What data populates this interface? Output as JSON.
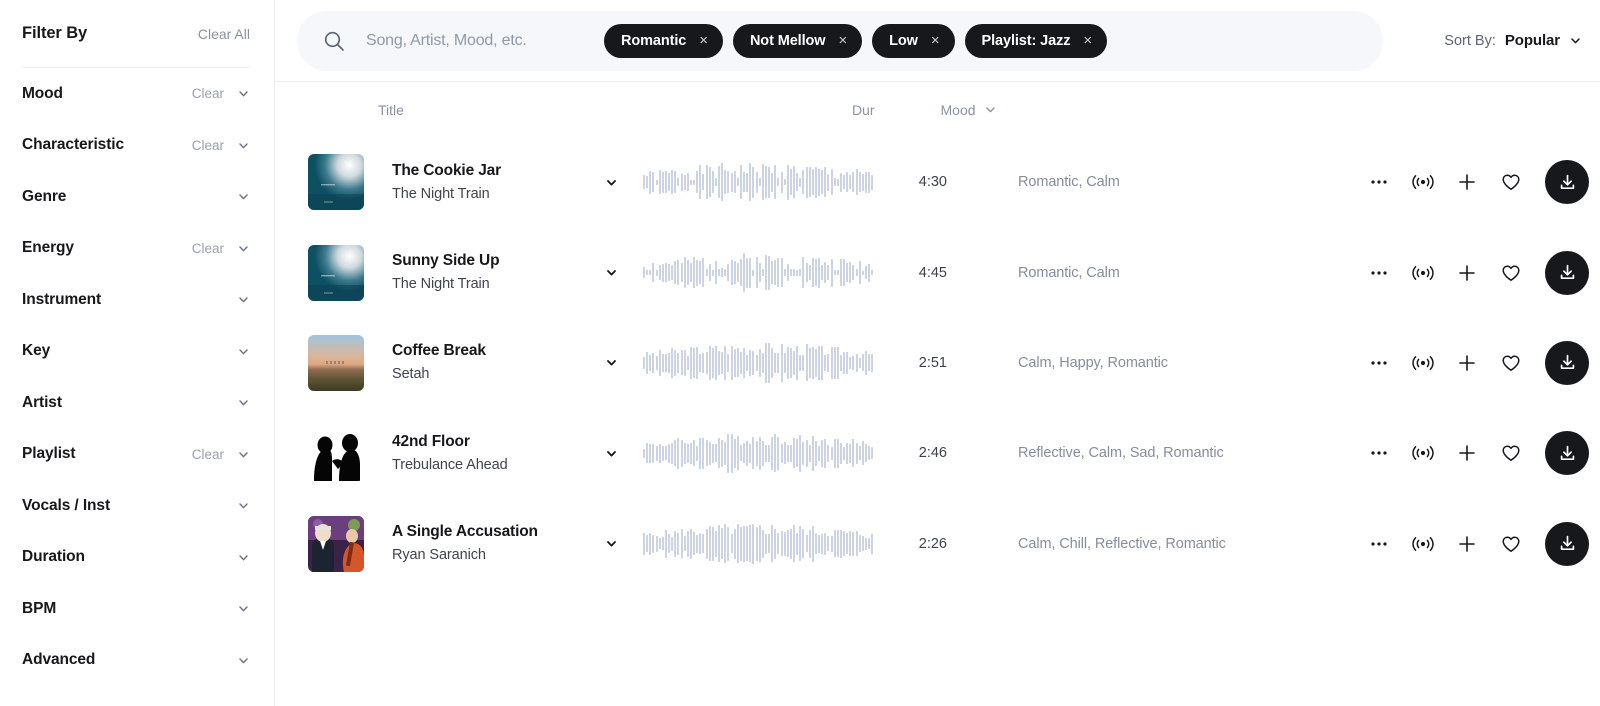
{
  "sidebar": {
    "title": "Filter By",
    "clear_all_label": "Clear All",
    "items": [
      {
        "label": "Mood",
        "clear": "Clear"
      },
      {
        "label": "Characteristic",
        "clear": "Clear"
      },
      {
        "label": "Genre",
        "clear": ""
      },
      {
        "label": "Energy",
        "clear": "Clear"
      },
      {
        "label": "Instrument",
        "clear": ""
      },
      {
        "label": "Key",
        "clear": ""
      },
      {
        "label": "Artist",
        "clear": ""
      },
      {
        "label": "Playlist",
        "clear": "Clear"
      },
      {
        "label": "Vocals / Inst",
        "clear": ""
      },
      {
        "label": "Duration",
        "clear": ""
      },
      {
        "label": "BPM",
        "clear": ""
      },
      {
        "label": "Advanced",
        "clear": ""
      }
    ]
  },
  "search": {
    "placeholder": "Song, Artist, Mood, etc.",
    "value": "",
    "chips": [
      {
        "label": "Romantic",
        "remove": "×"
      },
      {
        "label": "Not Mellow",
        "remove": "×"
      },
      {
        "label": "Low",
        "remove": "×"
      },
      {
        "label": "Playlist: Jazz",
        "remove": "×"
      }
    ]
  },
  "sort": {
    "label": "Sort By:",
    "value": "Popular"
  },
  "table": {
    "headers": {
      "title": "Title",
      "duration": "Dur",
      "mood": "Mood"
    },
    "rows": [
      {
        "title": "The Cookie Jar",
        "artist": "The Night Train",
        "duration": "4:30",
        "mood": "Romantic, Calm",
        "art": "teal-glow"
      },
      {
        "title": "Sunny Side Up",
        "artist": "The Night Train",
        "duration": "4:45",
        "mood": "Romantic, Calm",
        "art": "teal-glow"
      },
      {
        "title": "Coffee Break",
        "artist": "Setah",
        "duration": "2:51",
        "mood": "Calm, Happy, Romantic",
        "art": "sunset-field"
      },
      {
        "title": "42nd Floor",
        "artist": "Trebulance Ahead",
        "duration": "2:46",
        "mood": "Reflective, Calm, Sad, Romantic",
        "art": "black-silhouette"
      },
      {
        "title": "A Single Accusation",
        "artist": "Ryan Saranich",
        "duration": "2:26",
        "mood": "Calm, Chill, Reflective, Romantic",
        "art": "illustrated-musicians"
      }
    ],
    "row_actions": {
      "more": "more-options",
      "similar": "find-similar",
      "add": "add-to-project",
      "favorite": "favorite",
      "download": "download"
    }
  },
  "colors": {
    "accent_dark": "#17181b",
    "search_bg": "#f5f7fa",
    "waveform": "#ccd4e4",
    "muted_text": "#868d9e"
  }
}
